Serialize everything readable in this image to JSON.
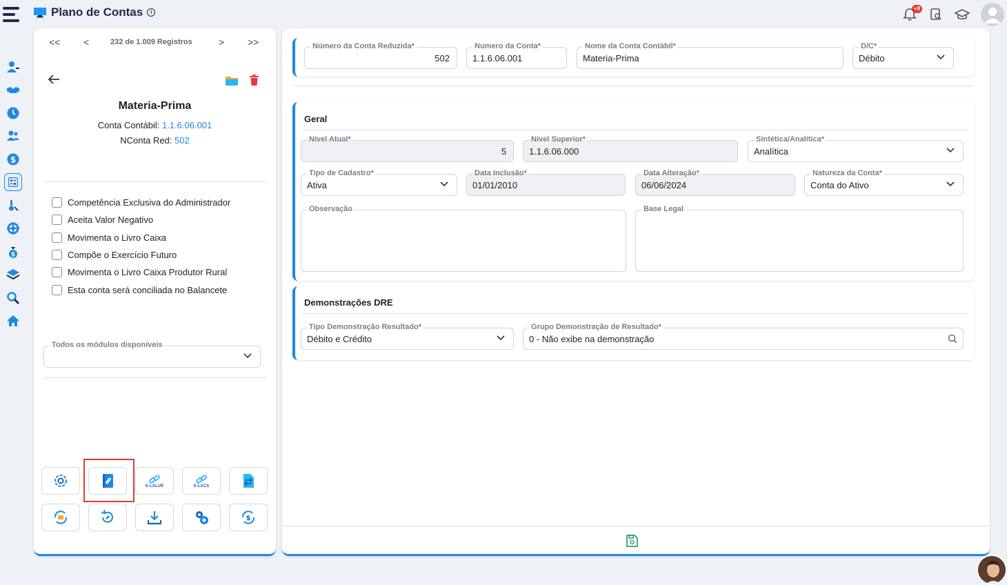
{
  "header": {
    "title": "Plano de Contas",
    "info_glyph": "i",
    "notification_badge": "+9"
  },
  "pager": {
    "first": "<<",
    "prev": "<",
    "text": "232 de 1.009 Registros",
    "next": ">",
    "last": ">>"
  },
  "account": {
    "name": "Materia-Prima",
    "conta_label": "Conta Contábil:",
    "conta_value": "1.1.6.06.001",
    "nconta_label": "NConta Red:",
    "nconta_value": "502"
  },
  "checkboxes": [
    "Competência Exclusiva do Administrador",
    "Aceita Valor Negativo",
    "Movimenta o Livro Caixa",
    "Compõe o Exercício Futuro",
    "Movimenta o Livro Caixa Produtor Rural",
    "Esta conta será conciliada no Balancete"
  ],
  "modules": {
    "label": "Todos os módulos disponíveis",
    "value": ""
  },
  "tools": {
    "elalur": "E-LALUR",
    "elacs": "E-LACS"
  },
  "top_fields": {
    "reduzida": {
      "label": "Número da Conta Reduzida*",
      "value": "502"
    },
    "numero": {
      "label": "Numero da Conta*",
      "value": "1.1.6.06.001"
    },
    "nome": {
      "label": "Nome da Conta Contábil*",
      "value": "Materia-Prima"
    },
    "dc": {
      "label": "D/C*",
      "value": "Débito"
    }
  },
  "geral": {
    "title": "Geral",
    "nivel_atual": {
      "label": "Nível Atual*",
      "value": "5"
    },
    "nivel_superior": {
      "label": "Nível Superior*",
      "value": "1.1.6.06.000"
    },
    "sintetica": {
      "label": "Sintética/Analítica*",
      "value": "Analítica"
    },
    "tipo_cadastro": {
      "label": "Tipo de Cadastro*",
      "value": "Ativa"
    },
    "data_inclusao": {
      "label": "Data Inclusão*",
      "value": "01/01/2010"
    },
    "data_alteracao": {
      "label": "Data Alteração*",
      "value": "06/06/2024"
    },
    "natureza": {
      "label": "Natureza da Conta*",
      "value": "Conta do Ativo"
    },
    "observacao": {
      "label": "Observação",
      "value": ""
    },
    "base_legal": {
      "label": "Base Legal",
      "value": ""
    }
  },
  "dre": {
    "title": "Demonstrações DRE",
    "tipo": {
      "label": "Tipo Demonstração Resultado*",
      "value": "Débito e Crédito"
    },
    "grupo": {
      "label": "Grupo Demonstração de Resultado*",
      "value": "0 - Não exibe na demonstração"
    }
  },
  "colors": {
    "accent": "#1e88e5",
    "navy": "#1e2a4a",
    "danger": "#e53935",
    "save": "#2e9e6e"
  }
}
